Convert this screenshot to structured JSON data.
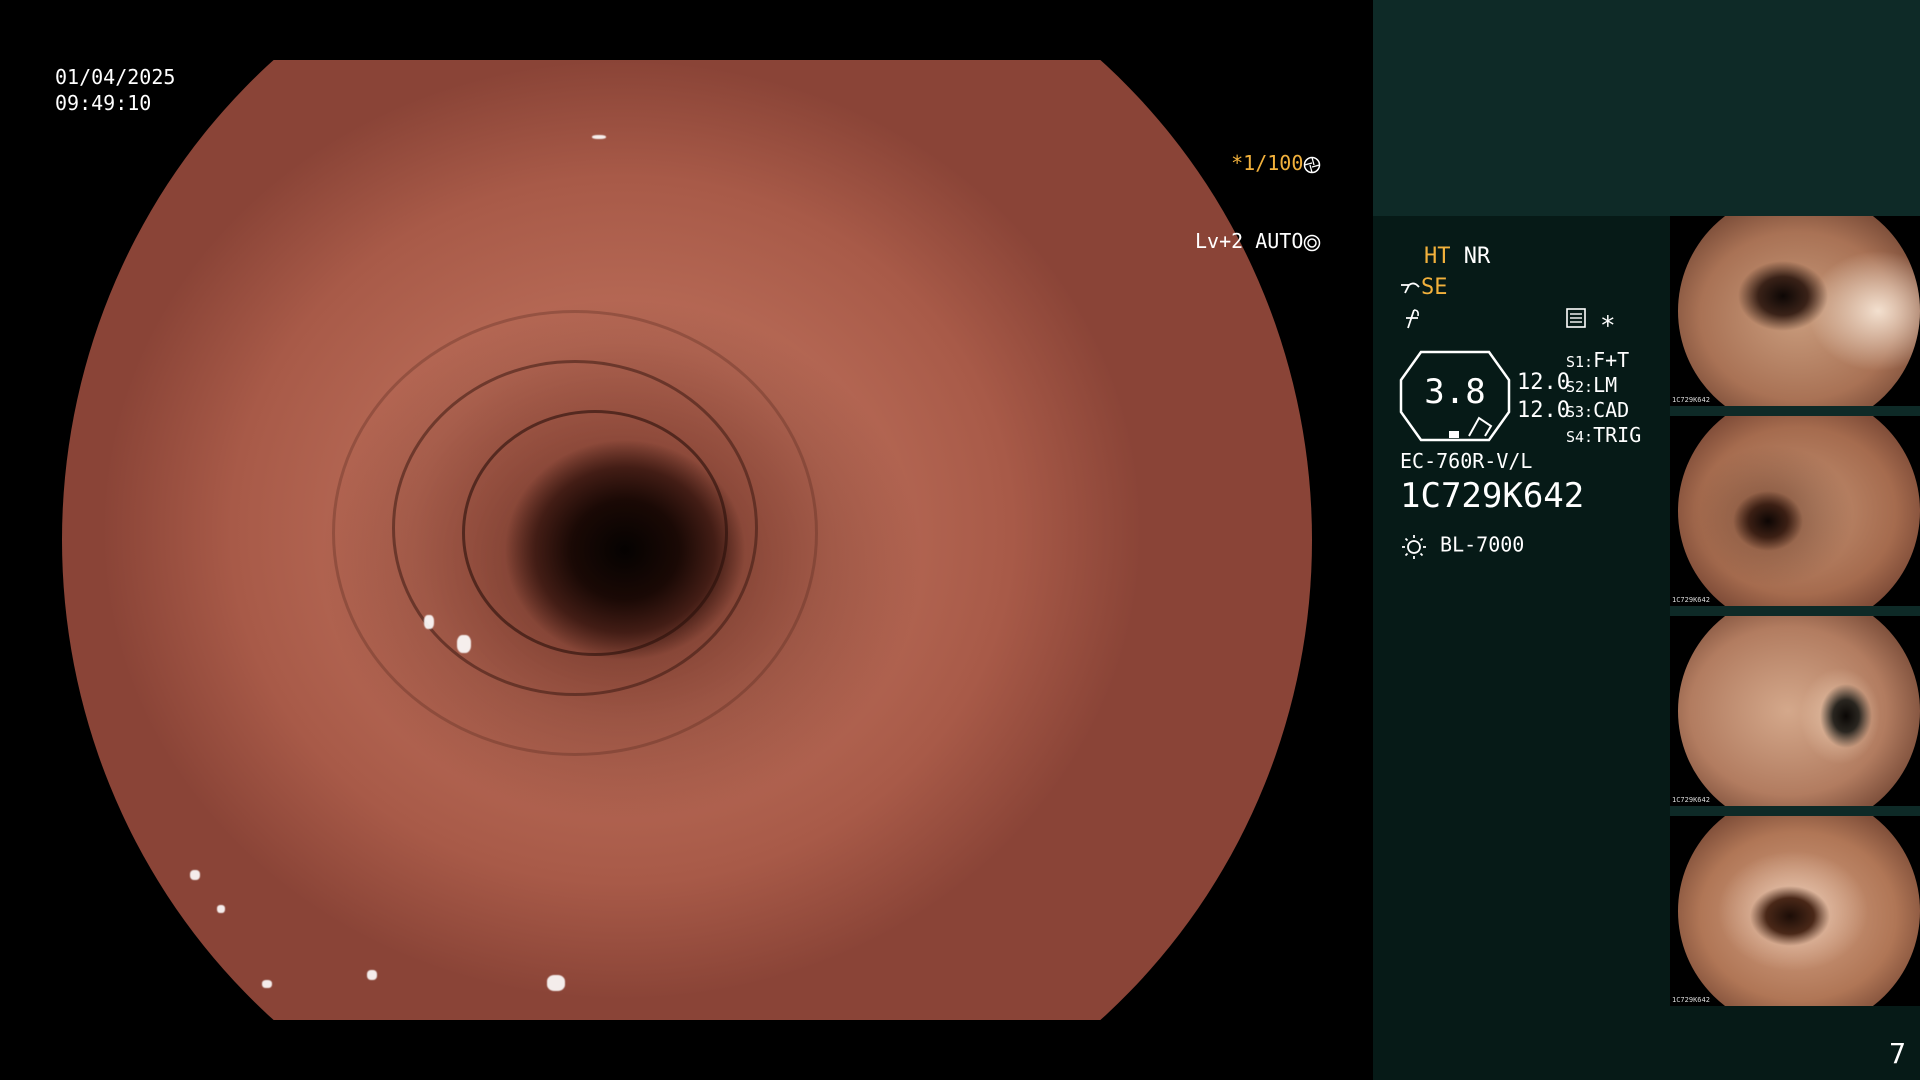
{
  "overlay": {
    "date": "01/04/2025",
    "time": "09:49:10",
    "shutter": "*1/100",
    "level": "Lv+2 AUTO"
  },
  "panel": {
    "mode_ht": "HT",
    "mode_nr": "NR",
    "mode_se": "SE",
    "zoom_value": "3.8",
    "value_1": "12.0",
    "value_2": "12.0",
    "switches": [
      {
        "key": "S1:",
        "value": "F+T"
      },
      {
        "key": "S2:",
        "value": "LM"
      },
      {
        "key": "S3:",
        "value": "CAD"
      },
      {
        "key": "S4:",
        "value": "TRIG"
      }
    ],
    "scope_model": "EC-760R-V/L",
    "serial": "1C729K642",
    "light_source": "BL-7000"
  },
  "thumbnails": [
    {
      "label": "1C729K642"
    },
    {
      "label": "1C729K642"
    },
    {
      "label": "1C729K642"
    },
    {
      "label": "1C729K642"
    }
  ],
  "page_number": "7",
  "colors": {
    "accent_orange": "#f2b13c",
    "panel_bg": "#061a17",
    "panel_top_bg": "#0e2a27"
  },
  "icons": {
    "shutter_icon": "aperture-icon",
    "level_icon": "target-icon",
    "light_icon": "sun-icon"
  }
}
